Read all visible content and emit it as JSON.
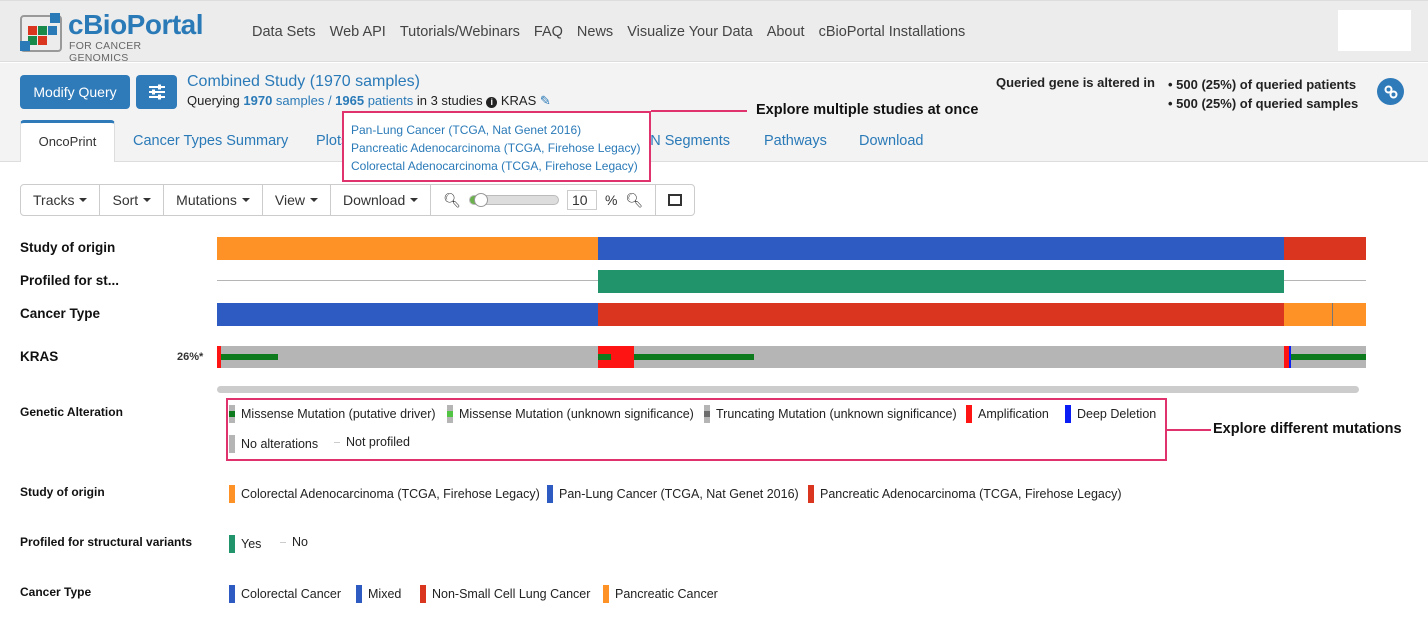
{
  "brand": {
    "title": "cBioPortal",
    "subtitle": "FOR CANCER GENOMICS"
  },
  "nav": [
    "Data Sets",
    "Web API",
    "Tutorials/Webinars",
    "FAQ",
    "News",
    "Visualize Your Data",
    "About",
    "cBioPortal Installations"
  ],
  "query": {
    "modify_label": "Modify Query",
    "study_title": "Combined Study (1970 samples)",
    "prefix": "Querying ",
    "samples_n": "1970",
    "samples_label": " samples",
    "sep": " / ",
    "patients_n": "1965",
    "patients_label": " patients",
    "studies": " in 3 studies",
    "gene": "KRAS",
    "altered_label": "Queried gene is altered in",
    "altered": [
      "• 500 (25%) of queried patients",
      "• 500 (25%) of queried samples"
    ]
  },
  "studies_popup": [
    "Pan-Lung Cancer (TCGA, Nat Genet 2016)",
    "Pancreatic Adenocarcinoma (TCGA, Firehose Legacy)",
    "Colorectal Adenocarcinoma (TCGA, Firehose Legacy)"
  ],
  "callouts": {
    "studies": "Explore multiple studies at once",
    "mutations": "Explore different mutations"
  },
  "tabs": [
    "OncoPrint",
    "Cancer Types Summary",
    "Plots",
    "CN Segments",
    "Pathways",
    "Download"
  ],
  "toolbar": {
    "items": [
      "Tracks",
      "Sort",
      "Mutations",
      "View",
      "Download"
    ],
    "zoom": "10",
    "zoom_unit": "%",
    "zoom_level": 0.05
  },
  "tracks": {
    "study": {
      "label": "Study of origin",
      "segments": [
        [
          0,
          0.332,
          "#ff9227"
        ],
        [
          0.332,
          0.929,
          "#2e5bc1"
        ],
        [
          0.929,
          1,
          "#d9351f"
        ]
      ]
    },
    "profiled": {
      "label": "Profiled for st...",
      "segments": [
        [
          0.332,
          0.929,
          "#21946b"
        ]
      ]
    },
    "cancer": {
      "label": "Cancer Type",
      "segments": [
        [
          0,
          0.332,
          "#2e5bc1"
        ],
        [
          0.332,
          0.929,
          "#d9351f"
        ],
        [
          0.929,
          1,
          "#ff9227"
        ]
      ]
    },
    "kras": {
      "label": "KRAS",
      "pct": "26%*"
    }
  },
  "colors": {
    "orange": "#ff9227",
    "blue": "#2e5bc1",
    "red": "#d9351f",
    "green": "#21946b",
    "amp": "#ff1414",
    "driver": "#0c7a1d",
    "vus": "#52c443",
    "trunc": "#6d6d6d",
    "deep": "#0b1df5",
    "noalt": "#b5b5b5"
  },
  "legend": {
    "genetic": {
      "title": "Genetic Alteration",
      "items": [
        "Missense Mutation (putative driver)",
        "Missense Mutation (unknown significance)",
        "Truncating Mutation (unknown significance)",
        "Amplification",
        "Deep Deletion",
        "No alterations",
        "Not profiled"
      ]
    },
    "study": {
      "title": "Study of origin",
      "items": [
        "Colorectal Adenocarcinoma (TCGA, Firehose Legacy)",
        "Pan-Lung Cancer (TCGA, Nat Genet 2016)",
        "Pancreatic Adenocarcinoma (TCGA, Firehose Legacy)"
      ]
    },
    "profiled": {
      "title": "Profiled for structural variants",
      "items": [
        "Yes",
        "No"
      ]
    },
    "cancer": {
      "title": "Cancer Type",
      "items": [
        "Colorectal Cancer",
        "Mixed",
        "Non-Small Cell Lung Cancer",
        "Pancreatic Cancer"
      ]
    }
  }
}
